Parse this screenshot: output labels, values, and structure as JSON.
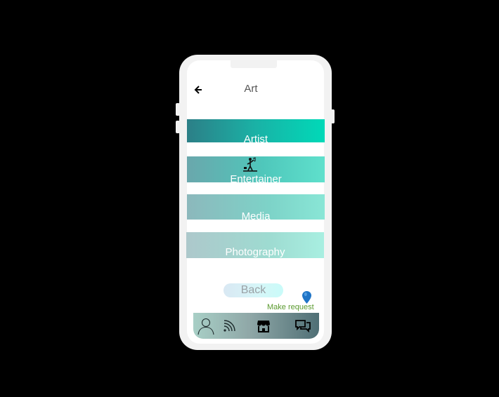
{
  "header": {
    "title": "Art",
    "back_icon": "arrow-left-icon"
  },
  "categories": [
    {
      "label": "Artist"
    },
    {
      "label": "Entertainer",
      "icon": "entertainer-icon"
    },
    {
      "label": "Media"
    },
    {
      "label": "Photography"
    }
  ],
  "actions": {
    "back_label": "Back",
    "make_request_label": "Make request",
    "make_request_icon": "map-pin-icon"
  },
  "bottom_nav": [
    {
      "icon": "user-icon"
    },
    {
      "icon": "feed-icon"
    },
    {
      "icon": "store-icon"
    },
    {
      "icon": "chat-icon"
    }
  ],
  "colors": {
    "background": "#000000",
    "phone_frame": "#f2f2f2",
    "accent_teal": "#00d9b8",
    "make_request_text": "#5a9a2e",
    "pin_blue": "#1f74c6"
  }
}
